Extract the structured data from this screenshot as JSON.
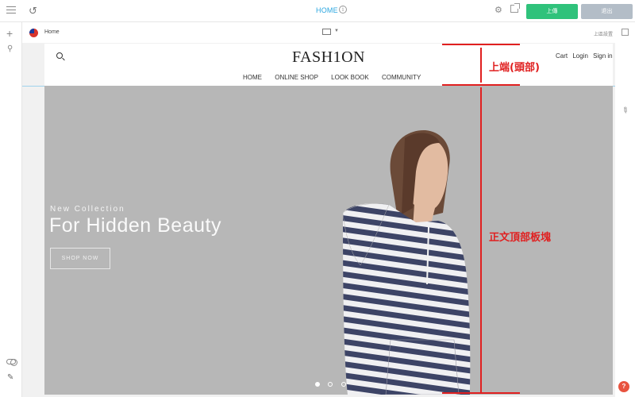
{
  "topbar": {
    "page_title": "HOME",
    "publish_label": "上傳",
    "exit_label": "退出",
    "info_icon": "i"
  },
  "subbar": {
    "page_name": "Home",
    "right_label": "上區設置"
  },
  "site": {
    "logo": "FASH1ON",
    "nav": [
      "HOME",
      "ONLINE SHOP",
      "LOOK BOOK",
      "COMMUNITY"
    ],
    "util": [
      "Cart",
      "Login",
      "Sign in"
    ]
  },
  "hero": {
    "kicker": "New Collection",
    "headline": "For Hidden Beauty",
    "button": "SHOP NOW",
    "slides": 3,
    "active_slide": 1
  },
  "annotations": {
    "header_label": "上端(頭部)",
    "body_label": "正文頂部板塊",
    "color": "#e02020"
  },
  "colors": {
    "accent": "#2aa6e0",
    "publish": "#2fc27b",
    "exit": "#b3bdc7",
    "hero_bg": "#b7b7b7",
    "help": "#e8533f"
  },
  "icons": [
    "menu-icon",
    "undo-icon",
    "info-icon",
    "gear-icon",
    "external-link-icon",
    "plus-icon",
    "magic-wand-icon",
    "toggle-icon",
    "pencil-icon",
    "pin-icon",
    "copy-icon",
    "help-icon",
    "flag-icon",
    "desktop-icon",
    "search-icon"
  ]
}
